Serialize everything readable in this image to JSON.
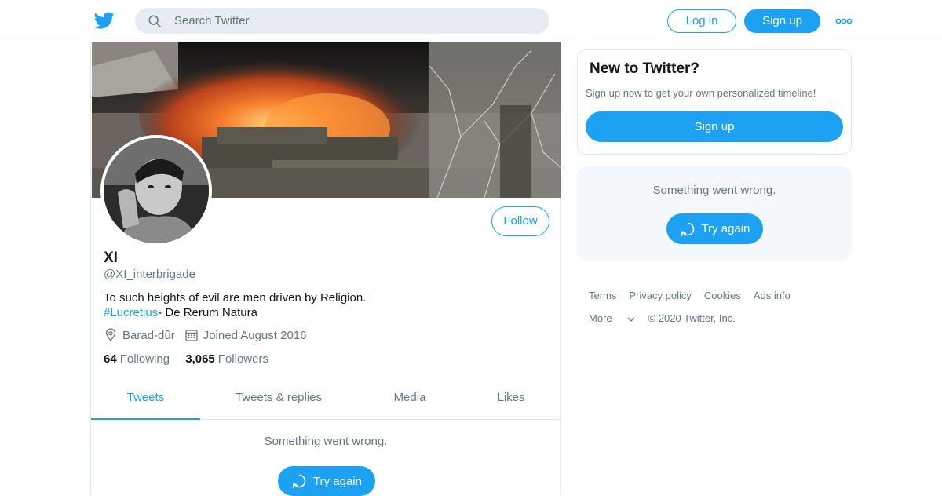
{
  "header": {
    "logo_icon": "twitter-bird-icon",
    "search_placeholder": "Search Twitter",
    "login_label": "Log in",
    "signup_label": "Sign up",
    "more_icon": "more-dots-icon"
  },
  "profile": {
    "display_name": "XI",
    "handle": "@XI_interbrigade",
    "bio_line1": "To such heights of evil are men driven by Religion.",
    "bio_hashtag": "#Lucretius",
    "bio_line2_rest": "- De Rerum Natura",
    "location": "Barad-dûr",
    "joined": "Joined August 2016",
    "following_count": "64",
    "following_label": "Following",
    "followers_count": "3,065",
    "followers_label": "Followers",
    "follow_label": "Follow"
  },
  "tabs": [
    {
      "label": "Tweets",
      "active": true
    },
    {
      "label": "Tweets & replies",
      "active": false
    },
    {
      "label": "Media",
      "active": false
    },
    {
      "label": "Likes",
      "active": false
    }
  ],
  "timeline": {
    "error_text": "Something went wrong.",
    "retry_label": "Try again"
  },
  "sidebar": {
    "signup_title": "New to Twitter?",
    "signup_sub": "Sign up now to get your own personalized timeline!",
    "signup_button": "Sign up",
    "error_text": "Something went wrong.",
    "retry_label": "Try again"
  },
  "footer": {
    "links": [
      "Terms",
      "Privacy policy",
      "Cookies",
      "Ads info"
    ],
    "more": "More",
    "copyright": "© 2020 Twitter, Inc."
  },
  "colors": {
    "accent": "#1da1f2",
    "muted": "#657786",
    "text": "#14171a"
  }
}
